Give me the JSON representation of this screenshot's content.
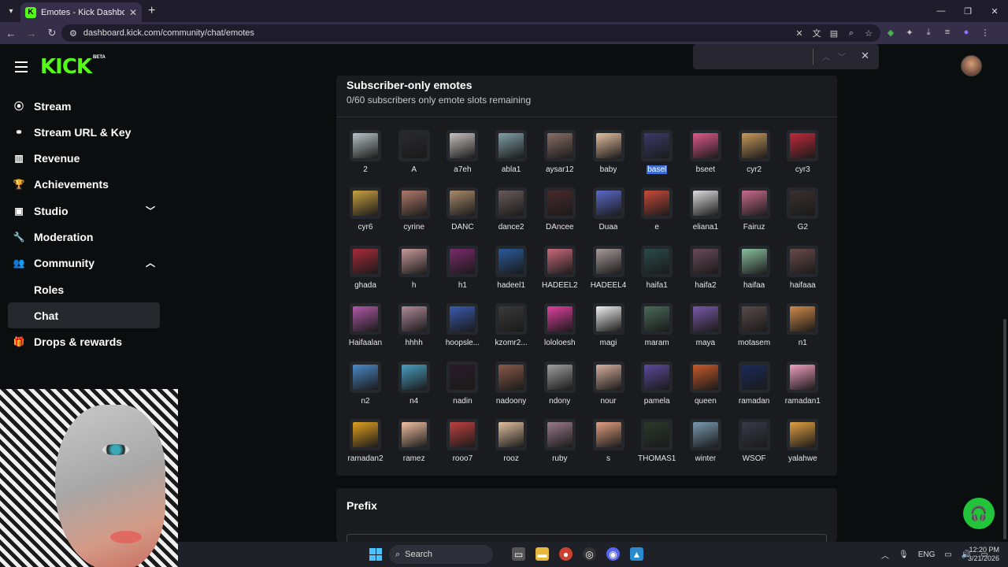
{
  "browser": {
    "tab_title": "Emotes - Kick Dashboard",
    "url": "dashboard.kick.com/community/chat/emotes"
  },
  "sidebar": {
    "logo": "KICK",
    "beta": "BETA",
    "items": [
      {
        "label": "Stream",
        "icon": "stream-icon"
      },
      {
        "label": "Stream URL & Key",
        "icon": "link-icon"
      },
      {
        "label": "Revenue",
        "icon": "revenue-icon"
      },
      {
        "label": "Achievements",
        "icon": "trophy-icon"
      },
      {
        "label": "Studio",
        "icon": "studio-icon"
      },
      {
        "label": "Moderation",
        "icon": "wrench-icon"
      },
      {
        "label": "Community",
        "icon": "community-icon"
      },
      {
        "label": "Drops & rewards",
        "icon": "gift-icon"
      }
    ],
    "sub_items": [
      {
        "label": "Roles"
      },
      {
        "label": "Chat"
      }
    ]
  },
  "emotes_panel": {
    "title": "Subscriber-only emotes",
    "subtitle": "0/60 subscribers only emote slots remaining",
    "emotes": [
      {
        "name": "2",
        "color": "#b9c4c8"
      },
      {
        "name": "A",
        "color": "#2a2a2e"
      },
      {
        "name": "a7eh",
        "color": "#c8c2c0"
      },
      {
        "name": "abla1",
        "color": "#7fa0a8"
      },
      {
        "name": "aysar12",
        "color": "#8a6f66"
      },
      {
        "name": "baby",
        "color": "#e4c0a0"
      },
      {
        "name": "basel",
        "color": "#3a3a6a"
      },
      {
        "name": "bseet",
        "color": "#e05a8a"
      },
      {
        "name": "cyr2",
        "color": "#c89a5a"
      },
      {
        "name": "cyr3",
        "color": "#c02a3a"
      },
      {
        "name": "cyr6",
        "color": "#c8a040"
      },
      {
        "name": "cyrine",
        "color": "#b07a6a"
      },
      {
        "name": "DANC",
        "color": "#a88a6a"
      },
      {
        "name": "dance2",
        "color": "#6a5a5a"
      },
      {
        "name": "DAncee",
        "color": "#4a2a2a"
      },
      {
        "name": "Duaa",
        "color": "#5a6ac8"
      },
      {
        "name": "e",
        "color": "#c84a3a"
      },
      {
        "name": "eliana1",
        "color": "#dcdcdc"
      },
      {
        "name": "Fairuz",
        "color": "#c86a8a"
      },
      {
        "name": "G2",
        "color": "#3a3030"
      },
      {
        "name": "ghada",
        "color": "#a82a3a"
      },
      {
        "name": "h",
        "color": "#c89a9a"
      },
      {
        "name": "h1",
        "color": "#7a2a6a"
      },
      {
        "name": "hadeel1",
        "color": "#2a5a9a"
      },
      {
        "name": "HADEEL2",
        "color": "#c86a7a"
      },
      {
        "name": "HADEEL4",
        "color": "#a89a9a"
      },
      {
        "name": "haifa1",
        "color": "#2a4a4a"
      },
      {
        "name": "haifa2",
        "color": "#6a4a5a"
      },
      {
        "name": "haifaa",
        "color": "#8ac0a0"
      },
      {
        "name": "haifaaa",
        "color": "#6a4a4a"
      },
      {
        "name": "Haifaalan",
        "color": "#b05aa8"
      },
      {
        "name": "hhhh",
        "color": "#b08a9a"
      },
      {
        "name": "hoopsle...",
        "color": "#3a5ab0"
      },
      {
        "name": "kzomr2...",
        "color": "#3a3a3a"
      },
      {
        "name": "lololoesh",
        "color": "#e040a0"
      },
      {
        "name": "magi",
        "color": "#f0f0f0"
      },
      {
        "name": "maram",
        "color": "#4a6a5a"
      },
      {
        "name": "maya",
        "color": "#7a5aa8"
      },
      {
        "name": "motasem",
        "color": "#5a4a4a"
      },
      {
        "name": "n1",
        "color": "#d08a4a"
      },
      {
        "name": "n2",
        "color": "#4a8ac8"
      },
      {
        "name": "n4",
        "color": "#4aa0c0"
      },
      {
        "name": "nadin",
        "color": "#2a1a2a"
      },
      {
        "name": "nadoony",
        "color": "#8a5a4a"
      },
      {
        "name": "ndony",
        "color": "#a0a0a0"
      },
      {
        "name": "nour",
        "color": "#d8b0a0"
      },
      {
        "name": "pamela",
        "color": "#5a4a9a"
      },
      {
        "name": "queen",
        "color": "#c85a2a"
      },
      {
        "name": "ramadan",
        "color": "#1a2a5a"
      },
      {
        "name": "ramadan1",
        "color": "#f0a0c0"
      },
      {
        "name": "ramadan2",
        "color": "#e0a020"
      },
      {
        "name": "ramez",
        "color": "#f0c0a0"
      },
      {
        "name": "rooo7",
        "color": "#c04040"
      },
      {
        "name": "rooz",
        "color": "#e0c0a0"
      },
      {
        "name": "ruby",
        "color": "#9a7a8a"
      },
      {
        "name": "s",
        "color": "#e0a080"
      },
      {
        "name": "THOMAS1",
        "color": "#2a3a2a"
      },
      {
        "name": "winter",
        "color": "#7a9ab0"
      },
      {
        "name": "WSOF",
        "color": "#3a3a4a"
      },
      {
        "name": "yalahwe",
        "color": "#e0a040"
      }
    ]
  },
  "prefix_panel": {
    "title": "Prefix"
  },
  "taskbar": {
    "search_label": "Search",
    "lang": "ENG",
    "time": "12:20 PM",
    "date": "3/21/2026"
  }
}
